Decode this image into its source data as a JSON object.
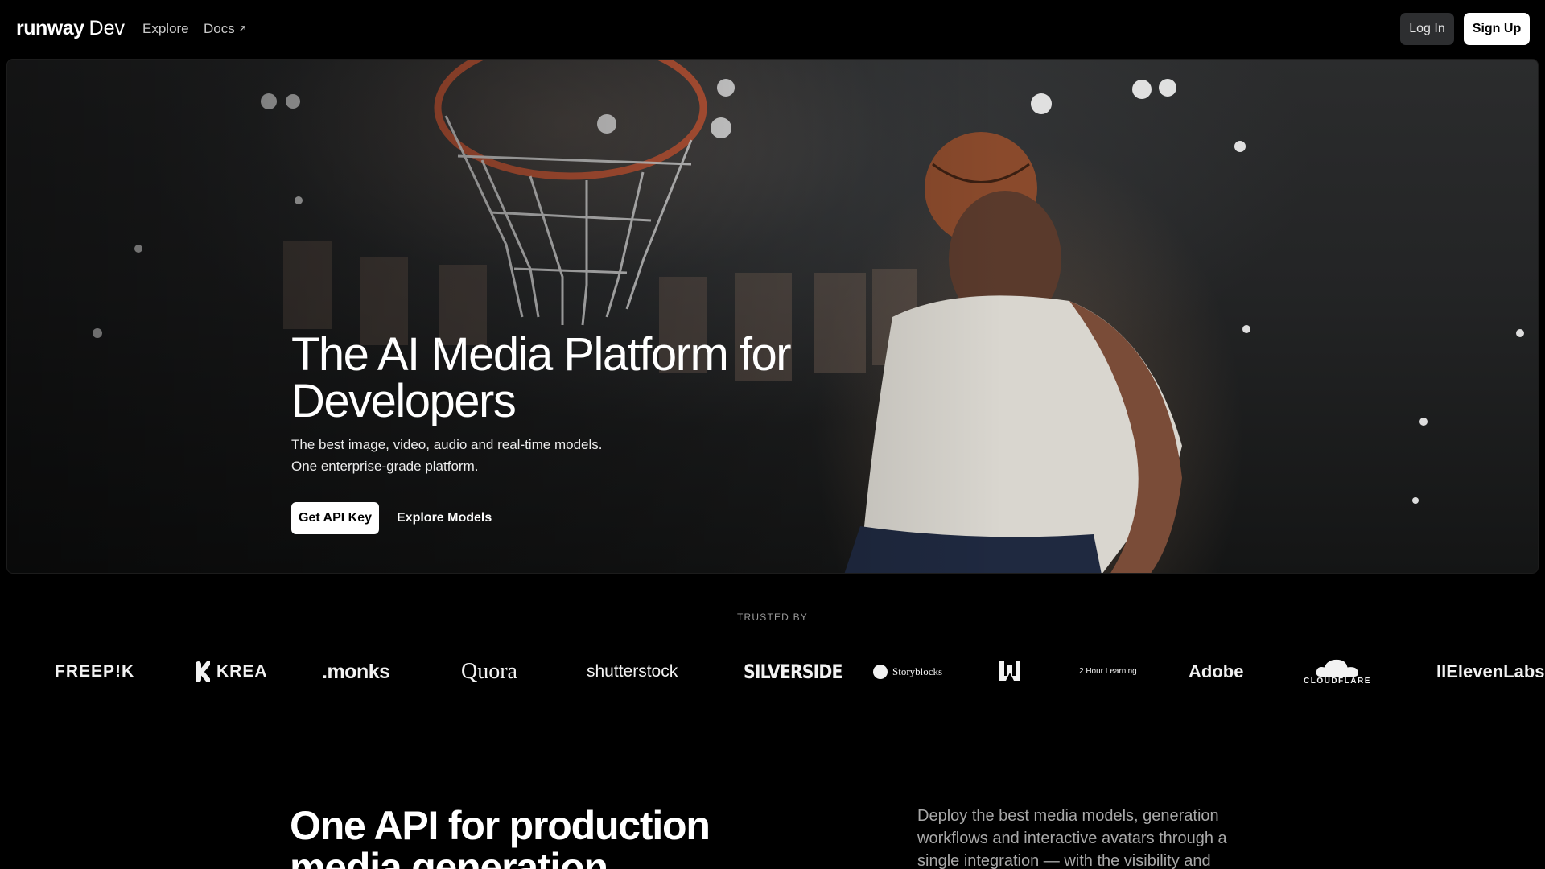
{
  "nav": {
    "logo_main": "runway",
    "logo_sub": "Dev",
    "links": [
      {
        "label": "Explore"
      },
      {
        "label": "Docs",
        "icon": "external-arrow-icon"
      }
    ],
    "login_label": "Log In",
    "signup_label": "Sign Up"
  },
  "hero": {
    "title": "The AI Media Platform for Developers",
    "subtitle_line1": "The best image, video, audio and real-time models.",
    "subtitle_line2": "One enterprise-grade platform.",
    "primary_cta": "Get API Key",
    "secondary_cta": "Explore Models",
    "background": "photo of a basketball player dunking toward a hoop in an arena"
  },
  "trusted": {
    "label": "TRUSTED BY",
    "brands": [
      "FREEP!K",
      "KREA",
      ".monks",
      "Quora",
      "shutterstock",
      "SILVERSIDE",
      "Storyblocks",
      "W",
      "2 Hour Learning",
      "Adobe",
      "CLOUDFLARE",
      "IIElevenLabs"
    ]
  },
  "section2": {
    "title": "One API for production media generation",
    "text": "Deploy the best media models, generation workflows and interactive avatars through a single integration — with the visibility and"
  },
  "colors": {
    "background": "#000000",
    "login_bg": "#2d2e30",
    "button_light": "#ffffff",
    "muted_text": "#a8a8a8"
  }
}
